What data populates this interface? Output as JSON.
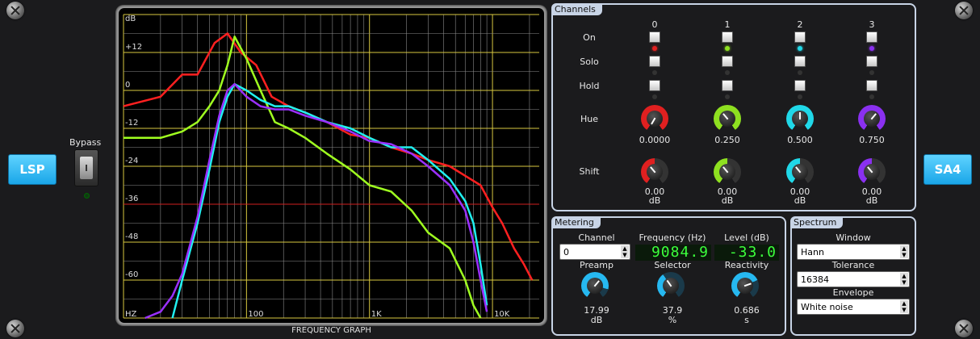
{
  "side": {
    "left_button": "LSP",
    "right_button": "SA4",
    "bypass_label": "Bypass"
  },
  "graph": {
    "title": "FREQUENCY GRAPH",
    "y_unit": "dB",
    "y_ticks": [
      "+12",
      "0",
      "-12",
      "-24",
      "-36",
      "-48",
      "-60"
    ],
    "x_ticks": [
      "HZ",
      "100",
      "1K",
      "10K"
    ]
  },
  "chart_data": {
    "type": "line",
    "title": "FREQUENCY GRAPH",
    "xlabel": "",
    "ylabel": "dB",
    "x_scale": "log",
    "xlim": [
      10,
      24000
    ],
    "ylim": [
      -72,
      24
    ],
    "series": [
      {
        "color": "#ff2020",
        "x": [
          10,
          20,
          30,
          40,
          55,
          70,
          90,
          120,
          160,
          220,
          300,
          450,
          700,
          1000,
          1500,
          2200,
          3000,
          4500,
          6000,
          8000,
          10000,
          12000,
          15000,
          18000,
          21000
        ],
        "y": [
          -5,
          -2,
          5,
          5,
          15,
          18,
          12,
          8,
          -2,
          -5,
          -7,
          -10,
          -14,
          -15,
          -18,
          -20,
          -22,
          -24,
          -27,
          -30,
          -37,
          -42,
          -50,
          -55,
          -60
        ]
      },
      {
        "color": "#a0ff20",
        "x": [
          10,
          20,
          30,
          40,
          50,
          60,
          70,
          80,
          100,
          130,
          170,
          220,
          300,
          450,
          700,
          1000,
          1500,
          2200,
          3000,
          4500,
          6000,
          7000,
          8000
        ],
        "y": [
          -15,
          -15,
          -13,
          -10,
          -5,
          0,
          8,
          17,
          10,
          0,
          -10,
          -12,
          -15,
          -20,
          -25,
          -30,
          -32,
          -38,
          -45,
          -50,
          -60,
          -68,
          -72
        ]
      },
      {
        "color": "#20f0f0",
        "x": [
          25,
          30,
          40,
          50,
          60,
          70,
          80,
          100,
          130,
          170,
          220,
          300,
          450,
          700,
          1000,
          1500,
          2200,
          3000,
          4500,
          6000,
          7000,
          8000,
          9000
        ],
        "y": [
          -72,
          -60,
          -42,
          -25,
          -10,
          -2,
          2,
          0,
          -3,
          -5,
          -5,
          -7,
          -10,
          -12,
          -15,
          -18,
          -18,
          -22,
          -28,
          -35,
          -42,
          -55,
          -68
        ]
      },
      {
        "color": "#9a30ff",
        "x": [
          15,
          20,
          25,
          30,
          40,
          50,
          60,
          70,
          80,
          100,
          130,
          170,
          220,
          300,
          450,
          700,
          1000,
          1500,
          2200,
          3000,
          4500,
          6000,
          7000,
          8000,
          9000
        ],
        "y": [
          -72,
          -70,
          -65,
          -58,
          -40,
          -22,
          -8,
          0,
          2,
          -2,
          -5,
          -6,
          -6,
          -8,
          -10,
          -13,
          -16,
          -17,
          -20,
          -24,
          -30,
          -38,
          -48,
          -60,
          -70
        ]
      }
    ]
  },
  "channels": {
    "title": "Channels",
    "row_labels": {
      "on": "On",
      "solo": "Solo",
      "hold": "Hold",
      "hue": "Hue",
      "shift": "Shift"
    },
    "items": [
      {
        "index": "0",
        "hue": "0.0000",
        "shift": "0.00",
        "shift_unit": "dB",
        "color": "#e02020"
      },
      {
        "index": "1",
        "hue": "0.250",
        "shift": "0.00",
        "shift_unit": "dB",
        "color": "#8ee020"
      },
      {
        "index": "2",
        "hue": "0.500",
        "shift": "0.00",
        "shift_unit": "dB",
        "color": "#20d8e8"
      },
      {
        "index": "3",
        "hue": "0.750",
        "shift": "0.00",
        "shift_unit": "dB",
        "color": "#8a30f0"
      }
    ]
  },
  "metering": {
    "title": "Metering",
    "channel_label": "Channel",
    "channel_value": "0",
    "frequency_label": "Frequency (Hz)",
    "frequency_value": "9084.9",
    "level_label": "Level (dB)",
    "level_value": "-33.0",
    "preamp_label": "Preamp",
    "preamp_value": "17.99",
    "preamp_unit": "dB",
    "selector_label": "Selector",
    "selector_value": "37.9",
    "selector_unit": "%",
    "reactivity_label": "Reactivity",
    "reactivity_value": "0.686",
    "reactivity_unit": "s"
  },
  "spectrum": {
    "title": "Spectrum",
    "window_label": "Window",
    "window_value": "Hann",
    "tolerance_label": "Tolerance",
    "tolerance_value": "16384",
    "envelope_label": "Envelope",
    "envelope_value": "White noise"
  }
}
